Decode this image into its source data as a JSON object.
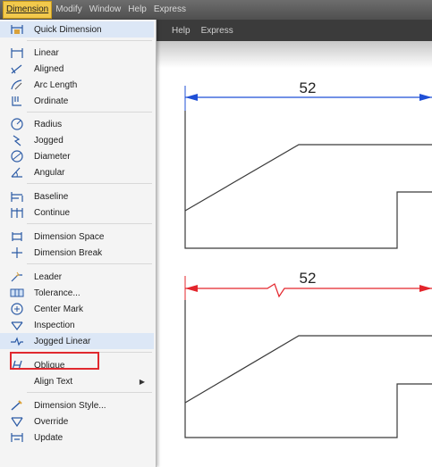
{
  "menubar": {
    "items": [
      "Dimension",
      "Modify",
      "Window",
      "Help",
      "Express"
    ]
  },
  "toolbar2": {
    "items": [
      "Help",
      "Express"
    ]
  },
  "menu": {
    "items": [
      {
        "label": "Quick Dimension",
        "icon": "quick-dimension-icon"
      },
      {
        "label": "Linear",
        "icon": "linear-icon"
      },
      {
        "label": "Aligned",
        "icon": "aligned-icon"
      },
      {
        "label": "Arc Length",
        "icon": "arc-length-icon"
      },
      {
        "label": "Ordinate",
        "icon": "ordinate-icon"
      },
      {
        "label": "Radius",
        "icon": "radius-icon"
      },
      {
        "label": "Jogged",
        "icon": "jogged-icon"
      },
      {
        "label": "Diameter",
        "icon": "diameter-icon"
      },
      {
        "label": "Angular",
        "icon": "angular-icon"
      },
      {
        "label": "Baseline",
        "icon": "baseline-icon"
      },
      {
        "label": "Continue",
        "icon": "continue-icon"
      },
      {
        "label": "Dimension Space",
        "icon": "dimension-space-icon"
      },
      {
        "label": "Dimension Break",
        "icon": "dimension-break-icon"
      },
      {
        "label": "Leader",
        "icon": "leader-icon"
      },
      {
        "label": "Tolerance...",
        "icon": "tolerance-icon"
      },
      {
        "label": "Center Mark",
        "icon": "center-mark-icon"
      },
      {
        "label": "Inspection",
        "icon": "inspection-icon"
      },
      {
        "label": "Jogged Linear",
        "icon": "jogged-linear-icon"
      },
      {
        "label": "Oblique",
        "icon": "oblique-icon"
      },
      {
        "label": "Align Text",
        "icon": ""
      },
      {
        "label": "Dimension Style...",
        "icon": "dimension-style-icon"
      },
      {
        "label": "Override",
        "icon": "override-icon"
      },
      {
        "label": "Update",
        "icon": "update-icon"
      }
    ],
    "highlighted": "Jogged Linear",
    "submenu_item": "Align Text"
  },
  "drawing": {
    "dim_top": "52",
    "dim_bottom": "52",
    "colors": {
      "top_dim": "#1f4fd6",
      "bottom_dim": "#e3242b",
      "outline": "#3a3a3a"
    }
  }
}
